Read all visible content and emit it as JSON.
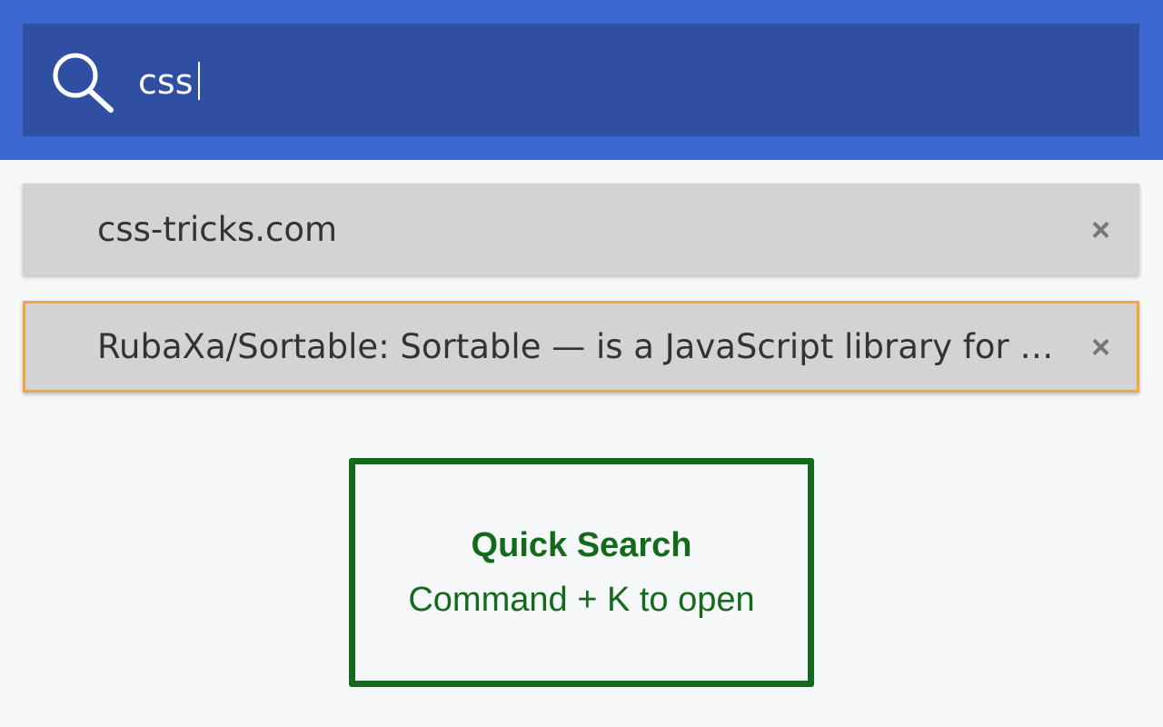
{
  "search": {
    "value": "css",
    "icon": "search-icon"
  },
  "results": [
    {
      "label": "css-tricks.com",
      "close_label": "×",
      "selected": false
    },
    {
      "label": "RubaXa/Sortable: Sortable — is a JavaScript library for …",
      "close_label": "×",
      "selected": true
    }
  ],
  "quick_search": {
    "title": "Quick Search",
    "subtitle": "Command + K to open"
  },
  "colors": {
    "header": "#3b67d1",
    "search_bar": "#2f4fa3",
    "result_bg": "#d3d3d3",
    "selected_border": "#efa93b",
    "accent_green": "#136a1c"
  }
}
